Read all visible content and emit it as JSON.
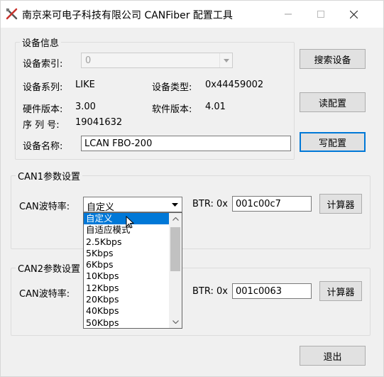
{
  "window": {
    "title": "南京来可电子科技有限公司 CANFiber 配置工具"
  },
  "device_info": {
    "group_title": "设备信息",
    "index_label": "设备索引:",
    "index_value": "0",
    "series_label": "设备系列:",
    "series_value": "LIKE",
    "type_label": "设备类型:",
    "type_value": "0x44459002",
    "hw_label": "硬件版本:",
    "hw_value": "3.00",
    "sw_label": "软件版本:",
    "sw_value": "4.01",
    "serial_label": "序 列 号:",
    "serial_value": "19041632",
    "name_label": "设备名称:",
    "name_value": "LCAN FBO-200"
  },
  "buttons": {
    "search": "搜索设备",
    "read": "读配置",
    "write": "写配置",
    "exit": "退出"
  },
  "can1": {
    "group_title": "CAN1参数设置",
    "baud_label": "CAN波特率:",
    "baud_value": "自定义",
    "btr_label": "BTR: 0x",
    "btr_value": "001c00c7",
    "calc_button": "计算器"
  },
  "can2": {
    "group_title": "CAN2参数设置",
    "baud_label": "CAN波特率:",
    "btr_label": "BTR: 0x",
    "btr_value": "001c0063",
    "calc_button": "计算器"
  },
  "baud_dropdown": {
    "options": [
      "自定义",
      "自适应模式",
      "2.5Kbps",
      "5Kbps",
      "6Kbps",
      "10Kbps",
      "12Kbps",
      "20Kbps",
      "40Kbps",
      "50Kbps"
    ],
    "selected_index": 0
  },
  "colors": {
    "accent": "#0078d7",
    "window_bg": "#f0f0f0"
  }
}
